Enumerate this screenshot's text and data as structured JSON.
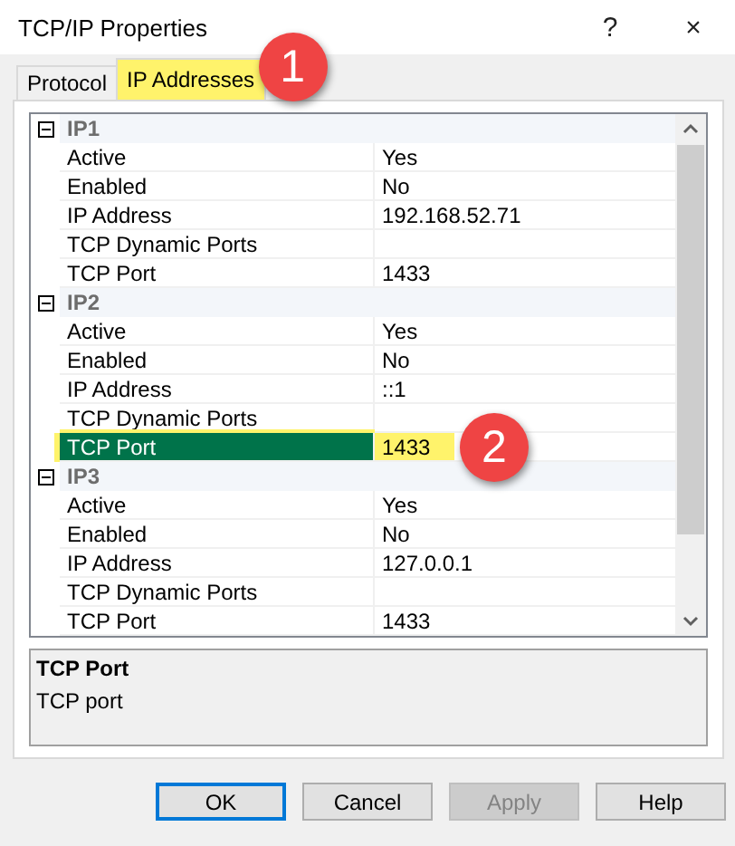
{
  "window": {
    "title": "TCP/IP Properties",
    "help": "?",
    "close": "×"
  },
  "tabs": [
    {
      "label": "Protocol",
      "selected": false,
      "highlighted": false
    },
    {
      "label": "IP Addresses",
      "selected": true,
      "highlighted": true,
      "badge": "1"
    }
  ],
  "groups": [
    {
      "name": "IP1",
      "expanded": true,
      "properties": [
        {
          "name": "Active",
          "value": "Yes",
          "selected": false,
          "highlighted": false
        },
        {
          "name": "Enabled",
          "value": "No",
          "selected": false,
          "highlighted": false
        },
        {
          "name": "IP Address",
          "value": "192.168.52.71",
          "selected": false,
          "highlighted": false
        },
        {
          "name": "TCP Dynamic Ports",
          "selected": false,
          "highlighted": false
        },
        {
          "name": "TCP Port",
          "value": "1433",
          "selected": false,
          "highlighted": false
        }
      ]
    },
    {
      "name": "IP2",
      "expanded": true,
      "properties": [
        {
          "name": "Active",
          "value": "Yes",
          "selected": false,
          "highlighted": false
        },
        {
          "name": "Enabled",
          "value": "No",
          "selected": false,
          "highlighted": false
        },
        {
          "name": "IP Address",
          "value": "::1",
          "selected": false,
          "highlighted": false
        },
        {
          "name": "TCP Dynamic Ports",
          "selected": false,
          "highlighted": false
        },
        {
          "name": "TCP Port",
          "value": "1433",
          "selected": true,
          "highlighted": true,
          "badge": "2"
        }
      ]
    },
    {
      "name": "IP3",
      "expanded": true,
      "properties": [
        {
          "name": "Active",
          "value": "Yes",
          "selected": false,
          "highlighted": false
        },
        {
          "name": "Enabled",
          "value": "No",
          "selected": false,
          "highlighted": false
        },
        {
          "name": "IP Address",
          "value": "127.0.0.1",
          "selected": false,
          "highlighted": false
        },
        {
          "name": "TCP Dynamic Ports",
          "selected": false,
          "highlighted": false
        },
        {
          "name": "TCP Port",
          "value": "1433",
          "selected": false,
          "highlighted": false
        }
      ]
    }
  ],
  "description": {
    "title": "TCP Port",
    "text": "TCP port"
  },
  "buttons": [
    {
      "label": "OK",
      "default": true,
      "disabled": false
    },
    {
      "label": "Cancel",
      "default": false,
      "disabled": false
    },
    {
      "label": "Apply",
      "default": false,
      "disabled": true
    },
    {
      "label": "Help",
      "default": false,
      "disabled": false
    }
  ]
}
